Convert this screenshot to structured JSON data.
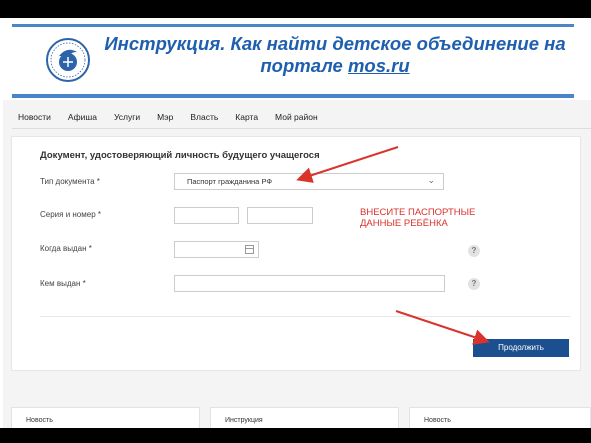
{
  "slide": {
    "title_line1": "Инструкция. Как найти детское объединение на",
    "title_line2": "портале ",
    "title_link": "mos.ru"
  },
  "colors": {
    "accent": "#4a84c9",
    "title": "#1f5fb0",
    "button": "#1c4f8f",
    "annotation": "#d9332b"
  },
  "nav": {
    "items": [
      "Новости",
      "Афиша",
      "Услуги",
      "Мэр",
      "Власть",
      "Карта",
      "Мой район"
    ]
  },
  "form": {
    "section_title": "Документ, удостоверяющий личность будущего учащегося",
    "doc_type": {
      "label": "Тип документа *",
      "value": "Паспорт гражданина РФ"
    },
    "series_number": {
      "label": "Серия и номер *"
    },
    "issue_date": {
      "label": "Когда выдан *"
    },
    "issued_by": {
      "label": "Кем выдан *"
    },
    "help": "?",
    "continue_label": "Продолжить"
  },
  "annotation": {
    "line1": "ВНЕСИТЕ ПАСПОРТНЫЕ",
    "line2": "ДАННЫЕ РЕБЁНКА"
  },
  "bottom_cards": [
    "Новость",
    "Инструкция",
    "Новость"
  ]
}
